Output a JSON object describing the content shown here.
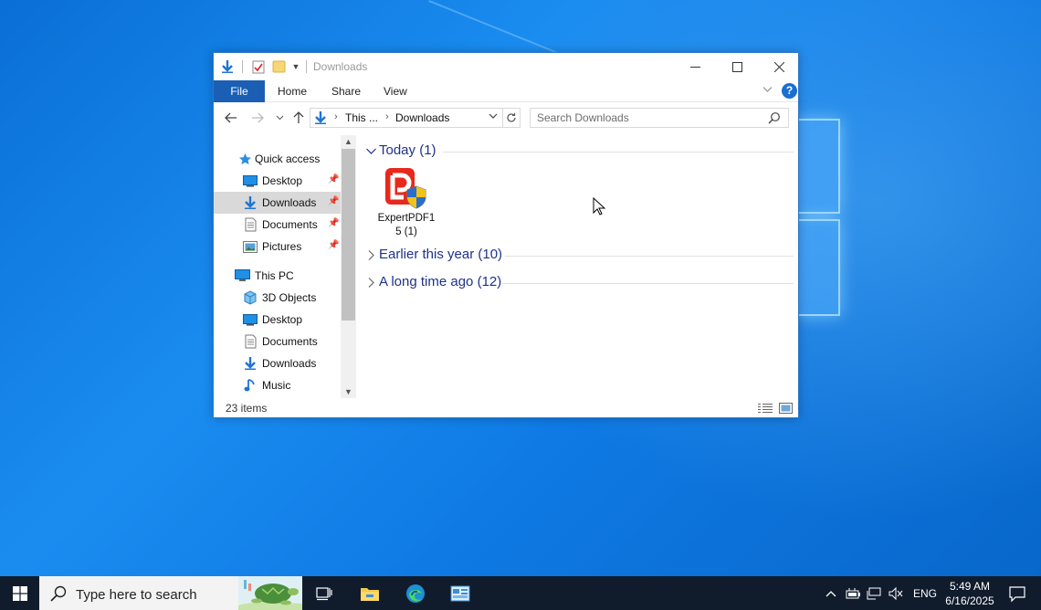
{
  "window": {
    "title": "Downloads",
    "ribbon_tabs": [
      "File",
      "Home",
      "Share",
      "View"
    ],
    "help_label": "?"
  },
  "address": {
    "segments": [
      "This ...",
      "Downloads"
    ]
  },
  "search": {
    "placeholder": "Search Downloads"
  },
  "nav_pane": {
    "quick_access_label": "Quick access",
    "quick_access_items": [
      {
        "label": "Desktop",
        "icon": "desktop-icon",
        "pinned": true
      },
      {
        "label": "Downloads",
        "icon": "downloads-icon",
        "pinned": true,
        "selected": true
      },
      {
        "label": "Documents",
        "icon": "documents-icon",
        "pinned": true
      },
      {
        "label": "Pictures",
        "icon": "pictures-icon",
        "pinned": true
      }
    ],
    "this_pc_label": "This PC",
    "this_pc_items": [
      {
        "label": "3D Objects",
        "icon": "3d-objects-icon"
      },
      {
        "label": "Desktop",
        "icon": "desktop-icon"
      },
      {
        "label": "Documents",
        "icon": "documents-icon"
      },
      {
        "label": "Downloads",
        "icon": "downloads-icon"
      },
      {
        "label": "Music",
        "icon": "music-icon"
      }
    ]
  },
  "content": {
    "groups": [
      {
        "title": "Today (1)",
        "expanded": true
      },
      {
        "title": "Earlier this year (10)",
        "expanded": false
      },
      {
        "title": "A long time ago (12)",
        "expanded": false
      }
    ],
    "files": [
      {
        "name": "ExpertPDF15 (1)",
        "name_line1": "ExpertPDF1",
        "name_line2": "5 (1)",
        "icon": "expertpdf-installer-icon"
      }
    ]
  },
  "status": {
    "item_count": "23 items"
  },
  "taskbar": {
    "search_placeholder": "Type here to search",
    "language": "ENG",
    "time": "5:49 AM",
    "date": "6/16/2025"
  },
  "colors": {
    "accent": "#1a5fb4",
    "group_title": "#1e3287",
    "taskbar": "#101c2c"
  }
}
